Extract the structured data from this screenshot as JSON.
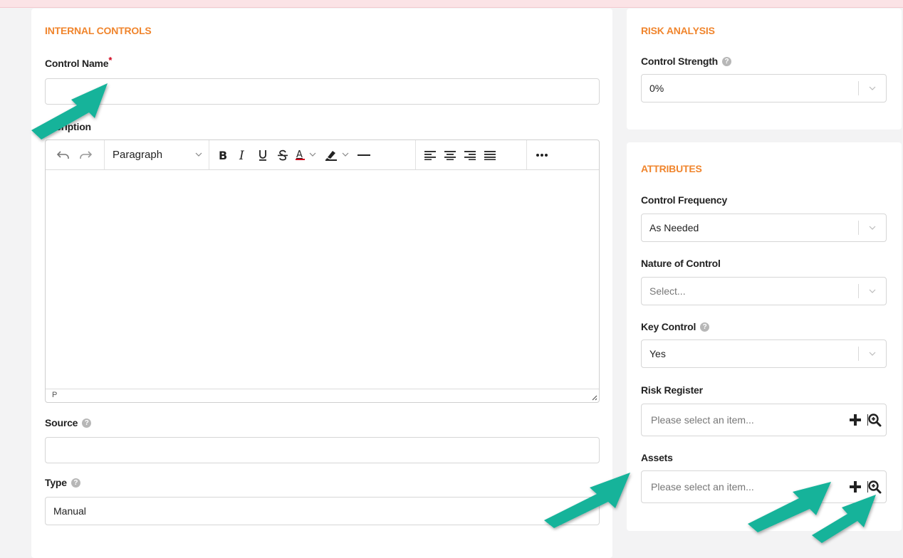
{
  "internal_controls": {
    "section_title": "INTERNAL CONTROLS",
    "control_name_label": "Control Name",
    "required_mark": "*",
    "control_name_value": "",
    "description_label": "escription",
    "editor": {
      "block_format": "Paragraph",
      "status_path": "P",
      "text_color_accent": "#d0021b",
      "highlight_color_accent": "#222222"
    },
    "source_label": "Source",
    "source_value": "",
    "type_label": "Type",
    "type_value": "Manual"
  },
  "risk_analysis": {
    "section_title": "RISK ANALYSIS",
    "control_strength_label": "Control Strength",
    "control_strength_value": "0%"
  },
  "attributes": {
    "section_title": "ATTRIBUTES",
    "control_frequency_label": "Control Frequency",
    "control_frequency_value": "As Needed",
    "nature_label": "Nature of Control",
    "nature_placeholder": "Select...",
    "key_control_label": "Key Control",
    "key_control_value": "Yes",
    "risk_register_label": "Risk Register",
    "risk_register_placeholder": "Please select an item...",
    "assets_label": "Assets",
    "assets_placeholder": "Please select an item..."
  },
  "colors": {
    "accent_orange": "#f0852d",
    "annotation_arrow": "#17b39a",
    "required": "#d0021b"
  },
  "icons": {
    "help": "question-circle-icon",
    "undo": "undo-icon",
    "redo": "redo-icon",
    "bold": "bold-icon",
    "italic": "italic-icon",
    "underline": "underline-icon",
    "strikethrough": "strikethrough-icon",
    "text_color": "text-color-icon",
    "highlight": "highlighter-icon",
    "horizontal_rule": "horizontal-rule-icon",
    "align_left": "align-left-icon",
    "align_center": "align-center-icon",
    "align_right": "align-right-icon",
    "align_justify": "align-justify-icon",
    "more": "more-icon",
    "add": "plus-icon",
    "search": "zoom-icon"
  }
}
